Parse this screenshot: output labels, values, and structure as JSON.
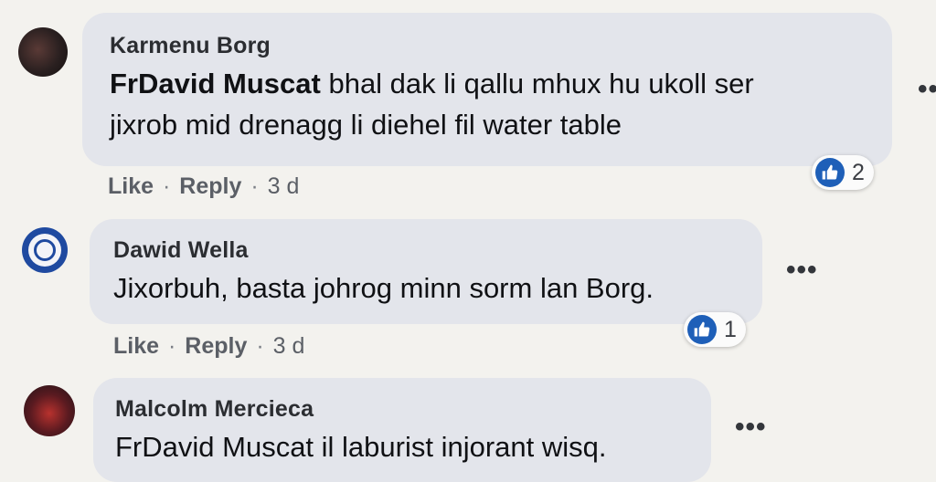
{
  "comments": [
    {
      "author": "Karmenu Borg",
      "mention": "FrDavid Muscat",
      "text_line1": " bhal dak li qallu mhux hu ukoll ser",
      "text_line2": "jixrob mid drenagg li diehel fil water table",
      "actions": {
        "like": "Like",
        "sep1": "·",
        "reply": "Reply",
        "sep2": "·",
        "time": "3 d"
      },
      "reactions": {
        "icon": "thumbs-up-icon",
        "count": "2"
      }
    },
    {
      "author": "Dawid Wella",
      "text_line1": "Jixorbuh, basta johrog minn sorm lan Borg.",
      "actions": {
        "like": "Like",
        "sep1": "·",
        "reply": "Reply",
        "sep2": "·",
        "time": "3 d"
      },
      "reactions": {
        "icon": "thumbs-up-icon",
        "count": "1"
      }
    },
    {
      "author": "Malcolm Mercieca",
      "mention": "FrDavid Muscat",
      "text_line1": " il laburist injorant wisq."
    }
  ],
  "more_options_label": "•••",
  "colors": {
    "like_blue": "#1e5fb8",
    "bubble": "#e3e5eb",
    "background": "#f3f2ee"
  }
}
